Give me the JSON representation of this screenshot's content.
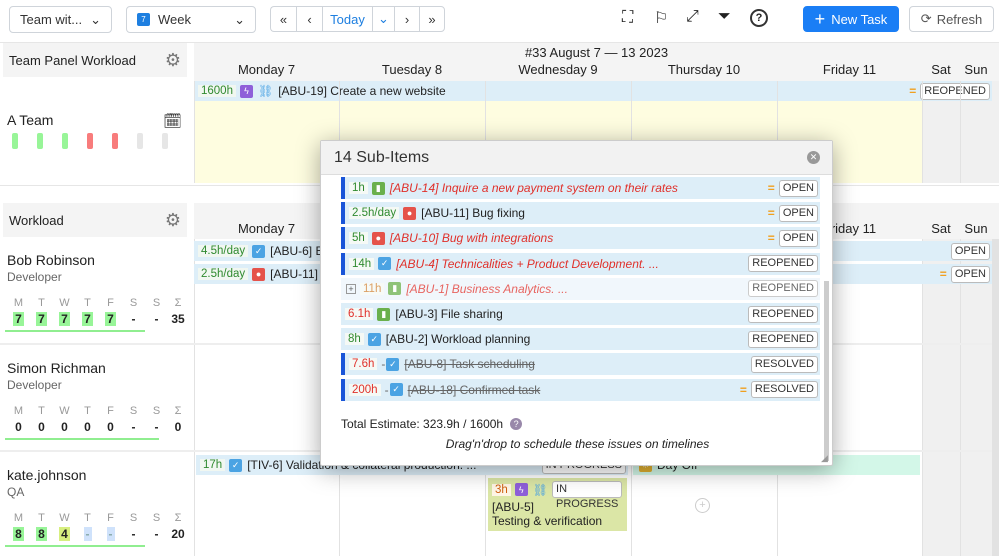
{
  "toolbar": {
    "team_select": "Team wit...",
    "view_select": "Week",
    "nav_today": "Today",
    "new_task": "New Task",
    "refresh": "Refresh",
    "calendar_day": "7"
  },
  "week_title": "#33 August 7 — 13 2023",
  "days": [
    "Monday 7",
    "Tuesday 8",
    "Wednesday 9",
    "Thursday 10",
    "Friday 11",
    "Sat",
    "Sun"
  ],
  "team_panel": {
    "title": "Team Panel Workload",
    "team_name": "A Team",
    "load_colors": [
      "#98f598",
      "#98f598",
      "#98f598",
      "#f87c7c",
      "#f87c7c",
      "#e6e6e6",
      "#e6e6e6"
    ]
  },
  "team_bar": {
    "estimate": "1600h",
    "title": "[ABU-19] Create a new website",
    "status": "REOPENED"
  },
  "workload": {
    "title": "Workload",
    "week_labels": [
      "M",
      "T",
      "W",
      "T",
      "F",
      "S",
      "S",
      "Σ"
    ],
    "people": [
      {
        "name": "Bob Robinson",
        "role": "Developer",
        "values": [
          "7",
          "7",
          "7",
          "7",
          "7",
          "-",
          "-",
          "35"
        ]
      },
      {
        "name": "Simon Richman",
        "role": "Developer",
        "values": [
          "0",
          "0",
          "0",
          "0",
          "0",
          "-",
          "-",
          "0"
        ]
      },
      {
        "name": "kate.johnson",
        "role": "QA",
        "values": [
          "8",
          "8",
          "4",
          "-",
          "-",
          "-",
          "-",
          "20"
        ]
      }
    ]
  },
  "bob_bars": [
    {
      "estimate": "4.5h/day",
      "title": "[ABU-6] E",
      "status": "OPEN"
    },
    {
      "estimate": "2.5h/day",
      "title": "[ABU-11]",
      "status": "OPEN"
    }
  ],
  "kate_bars": {
    "tiv": {
      "estimate": "17h",
      "title": "[TIV-6] Validation & collateral production. ...",
      "status": "IN PROGRESS"
    },
    "abu5": {
      "estimate": "3h",
      "status": "IN PROGRESS",
      "key": "[ABU-5]",
      "title": "Testing & verification"
    },
    "dayoff": "Day Off"
  },
  "popup": {
    "title": "14 Sub-Items",
    "total": "Total Estimate: 323.9h / 1600h",
    "hint": "Drag'n'drop to schedule these issues on timelines",
    "items": [
      {
        "estimate": "1h",
        "type": "story",
        "title": "[ABU-14] Inquire a new payment system on their rates",
        "status": "OPEN"
      },
      {
        "estimate": "2.5h/day",
        "type": "bug",
        "title": "[ABU-11] Bug fixing",
        "status": "OPEN"
      },
      {
        "estimate": "5h",
        "type": "bug",
        "title": "[ABU-10] Bug with integrations",
        "status": "OPEN"
      },
      {
        "estimate": "14h",
        "type": "task",
        "title": "[ABU-4] Technicalities + Product Development. ...",
        "status": "REOPENED"
      },
      {
        "estimate": "11h",
        "type": "story",
        "title": "[ABU-1] Business Analytics. ...",
        "status": "REOPENED"
      },
      {
        "estimate": "6.1h",
        "type": "story",
        "title": "[ABU-3] File sharing",
        "status": "REOPENED"
      },
      {
        "estimate": "8h",
        "type": "task",
        "title": "[ABU-2] Workload planning",
        "status": "REOPENED"
      },
      {
        "estimate": "7.6h",
        "type": "task",
        "title": "[ABU-8] Task scheduling",
        "status": "RESOLVED"
      },
      {
        "estimate": "200h",
        "type": "task",
        "title": "[ABU-18] Confirmed task",
        "status": "RESOLVED"
      }
    ]
  }
}
